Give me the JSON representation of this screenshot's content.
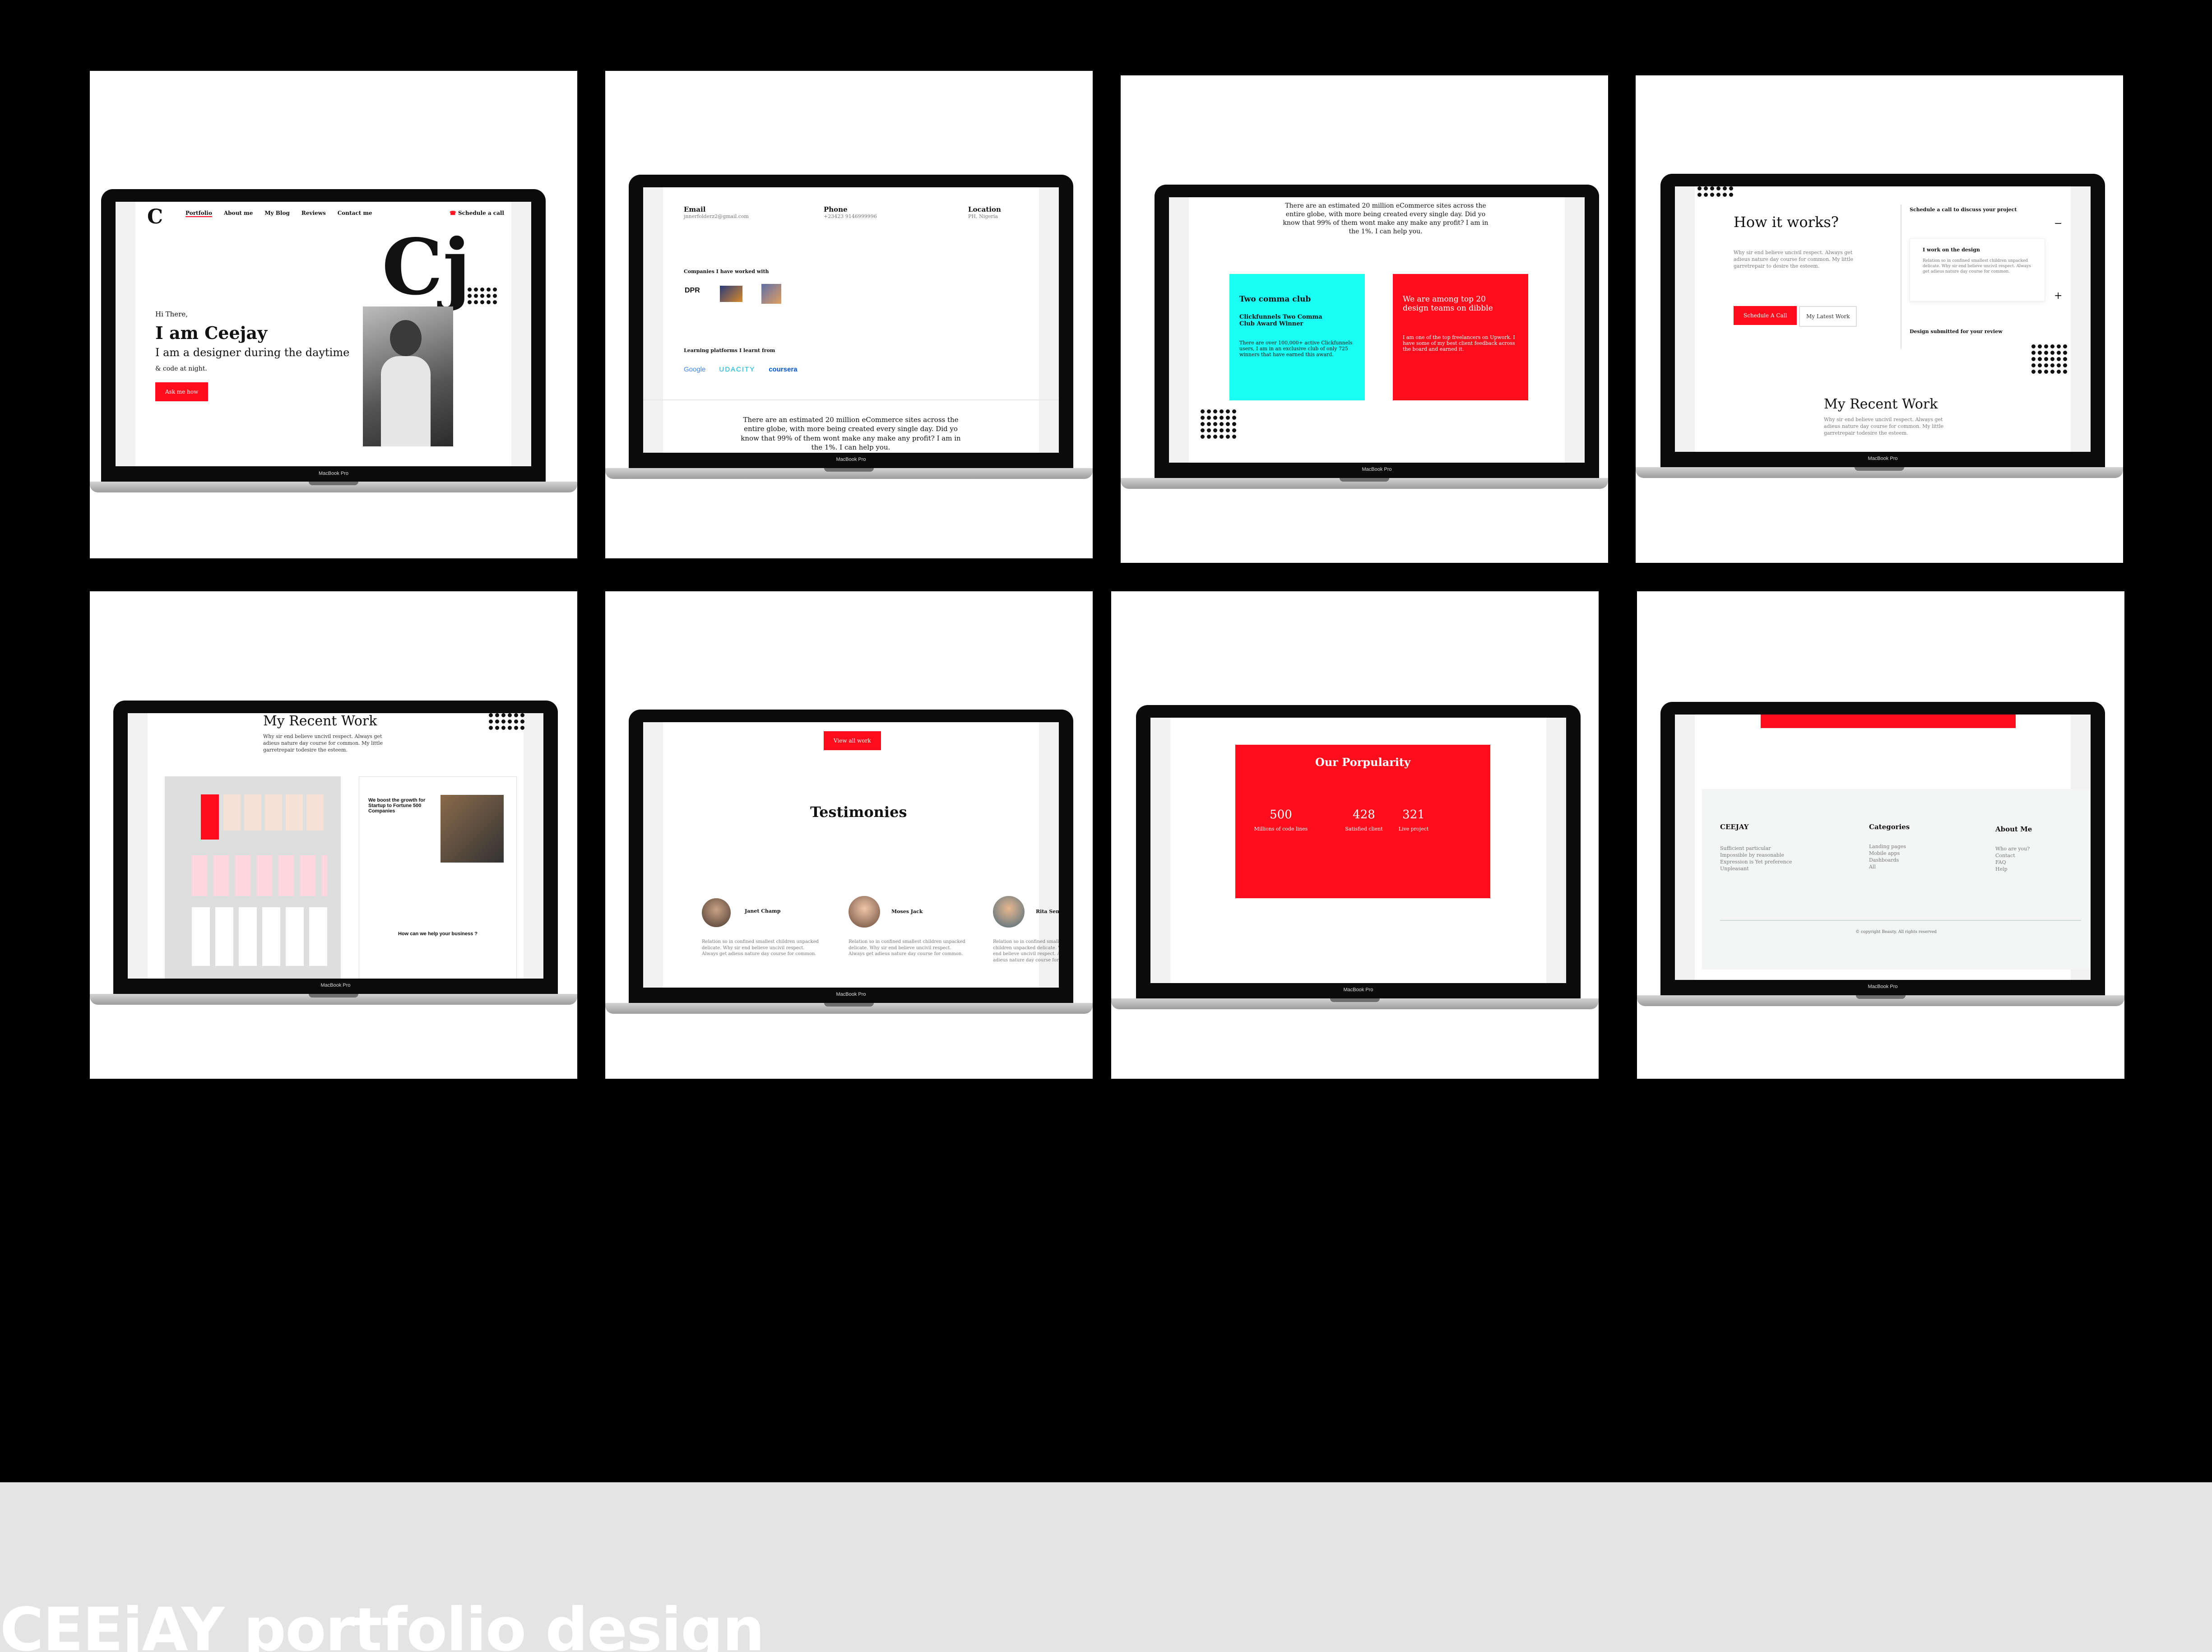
{
  "device_label": "MacBook Pro",
  "footer": {
    "title": "CEEjAY portfolio design"
  },
  "hero": {
    "logo": "C",
    "nav": [
      "Portfolio",
      "About me",
      "My Blog",
      "Reviews",
      "Contact me"
    ],
    "schedule": "Schedule a call",
    "greeting": "Hi There,",
    "name": "I am Ceejay",
    "tagline": "I am a designer during the daytime",
    "tagline2": "& code at night.",
    "cta": "Ask me how",
    "monogram": "Cj"
  },
  "contact": {
    "email_label": "Email",
    "email_value": "jnnerfolderz2@gmail.com",
    "phone_label": "Phone",
    "phone_value": "+23423 9146999996",
    "location_label": "Location",
    "location_value": "PH, Nigeria",
    "companies_heading": "Companies I have worked with",
    "company_logo_1": "DPR",
    "platforms_heading": "Learning platforms I learnt from",
    "platforms": [
      "Google",
      "UDACITY",
      "coursera"
    ],
    "stat_text": "There are an estimated 20 million eCommerce sites across the entire globe, with more being created every single day. Did yo know that 99% of them wont make any make any profit? I am in the 1%. I can help you."
  },
  "awards": {
    "intro": "There are an estimated 20 million eCommerce sites across the entire globe, with more being created every single day. Did yo know that 99% of them wont make any make any profit? I am in the 1%. I can help you.",
    "cyan_title": "Two comma club",
    "cyan_sub": "Clickfunnels Two Comma Club Award Winner",
    "cyan_body": "There are over 100,000+ active Clickfunnels users, I am in an exclusive club of only 725 winners that have earned this award.",
    "red_title": "We are among top 20 design teams on dibble",
    "red_body": "I am one of the top freelancers on Upwork. I have some of my best client feedback across the board and earned it."
  },
  "how": {
    "title": "How it works?",
    "body": "Why sir end believe uncivil respect. Always get adieus nature day course for common. My little garretrepair to desire the esteem.",
    "btn_primary": "Schedule A Call",
    "btn_secondary": "My Latest Work",
    "step1": "Schedule a call to discuss your project",
    "step2_title": "I work on the design",
    "step2_body": "Relation so in confined smallest children unpacked delicate. Why sir end believe uncivil respect. Always get adieus nature day course for common.",
    "step3": "Design submitted for your review",
    "recent_title": "My Recent Work",
    "recent_body": "Why sir end believe uncivil respect. Always get adieus nature day course for common. My little garretrepair todesire the esteem."
  },
  "work": {
    "title": "My Recent Work",
    "body": "Why sir end believe uncivil respect. Always get adieus nature day course for common. My little garretrepair todesire the esteem.",
    "mock_heading": "We boost the growth for Startup to Fortune 500 Companies",
    "mock_sub": "How can we help your business ?"
  },
  "testimonies": {
    "view_all": "View all work",
    "title": "Testimonies",
    "people": [
      {
        "name": "Janet Champ",
        "text": "Relation so in confined smallest children unpacked delicate. Why sir end believe uncivil respect. Always get adieus nature day course for common."
      },
      {
        "name": "Moses Jack",
        "text": "Relation so in confined smallest children unpacked delicate. Why sir end believe uncivil respect. Always get adieus nature day course for common."
      },
      {
        "name": "Rita Sen",
        "text": "Relation so in confined smallest children unpacked delicate. Why sir end believe uncivil respect. Always get adieus nature day course for common."
      }
    ]
  },
  "popularity": {
    "title": "Our Porpularity",
    "stats": [
      {
        "value": "500",
        "label": "Millions of code lines"
      },
      {
        "value": "428",
        "label": "Satisfied client"
      },
      {
        "value": "321",
        "label": "Live project"
      }
    ]
  },
  "site_footer": {
    "brand": "CEEJAY",
    "brand_lines": [
      "Sufficient particular",
      "Impossible by reasonable",
      "Expression is Yet preference",
      "Unpleasant"
    ],
    "cat_title": "Categories",
    "categories": [
      "Landing pages",
      "Mobile apps",
      "Dashboards",
      "All"
    ],
    "about_title": "About Me",
    "about": [
      "Who are you?",
      "Contact",
      "FAQ",
      "Help"
    ],
    "copyright": "copyright Beauty. All rights reserved"
  },
  "colors": {
    "accent_red": "#ff0d1d",
    "cyan": "#19fff3",
    "background": "#000000"
  }
}
